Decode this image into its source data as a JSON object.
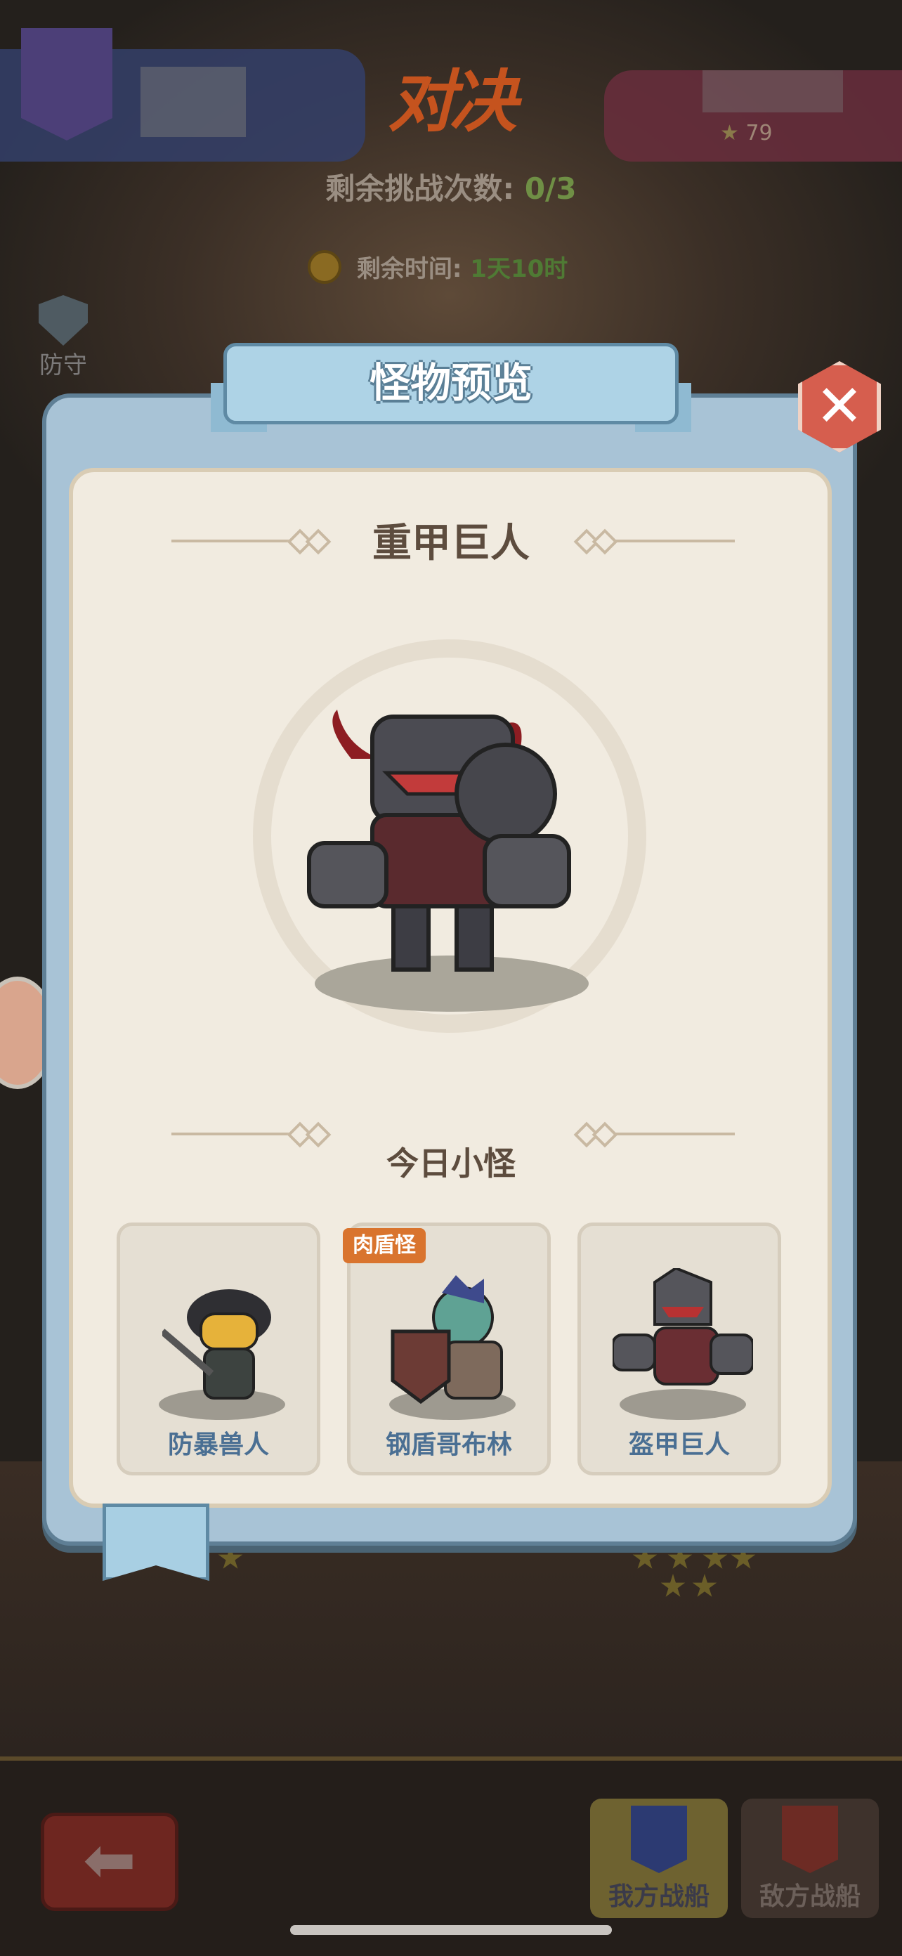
{
  "header": {
    "vs_title": "对决",
    "opponent_star_score": "79",
    "challenges_label": "剩余挑战次数:",
    "challenges_value": "0/3",
    "time_label": "剩余时间:",
    "time_value": "1天10时"
  },
  "side": {
    "defense_label": "防守"
  },
  "modal": {
    "title": "怪物预览",
    "close_icon": "close-icon",
    "boss_name": "重甲巨人",
    "minions_title": "今日小怪",
    "minions": [
      {
        "name": "防暴兽人",
        "tag": ""
      },
      {
        "name": "钢盾哥布林",
        "tag": "肉盾怪"
      },
      {
        "name": "盔甲巨人",
        "tag": ""
      }
    ]
  },
  "bottom": {
    "back_icon": "arrow-left-icon",
    "my_ship_label": "我方战船",
    "enemy_ship_label": "敌方战船"
  },
  "colors": {
    "modal_frame": "#a8c3d6",
    "panel": "#f1ebe0",
    "title_text": "#5d4c3e",
    "minion_label": "#4a6f93",
    "tag_bg": "#d9742e",
    "close_button": "#d65e4e"
  }
}
